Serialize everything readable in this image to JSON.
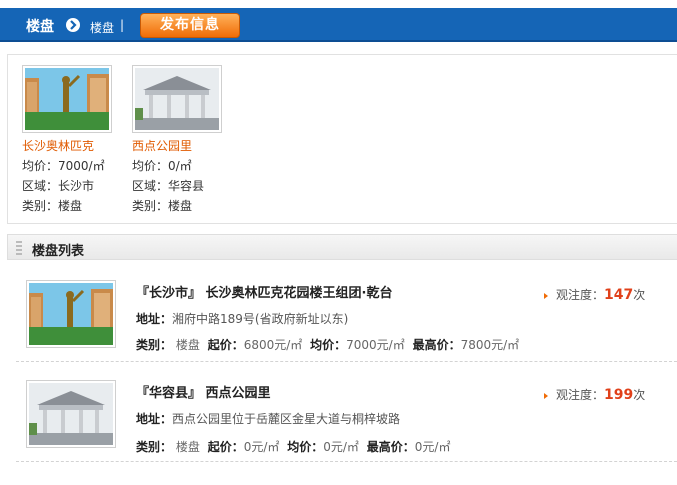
{
  "header": {
    "title": "楼盘",
    "crumb": "楼盘",
    "separator": "|",
    "publish_label": "发布信息"
  },
  "featured": [
    {
      "name": "长沙奥林匹克",
      "price": "均价：7000/㎡",
      "region": "区域：长沙市",
      "category": "类别：楼盘"
    },
    {
      "name": "西点公园里",
      "price": "均价：0/㎡",
      "region": "区域：华容县",
      "category": "类别：楼盘"
    }
  ],
  "list_section": {
    "title": "楼盘列表"
  },
  "list": [
    {
      "title": "『长沙市』 长沙奥林匹克花园楼王组团·乾台",
      "addr_label": "地址：",
      "addr": "湘府中路189号(省政府新址以东)",
      "type_label": "类别：",
      "type": "楼盘",
      "start_label": "起价：",
      "start": "6800元/㎡",
      "avg_label": "均价：",
      "avg": "7000元/㎡",
      "max_label": "最高价：",
      "max": "7800元/㎡",
      "views_label": "观注度：",
      "views": "147",
      "views_unit": "次"
    },
    {
      "title": "『华容县』 西点公园里",
      "addr_label": "地址：",
      "addr": "西点公园里位于岳麓区金星大道与桐梓坡路",
      "type_label": "类别：",
      "type": "楼盘",
      "start_label": "起价：",
      "start": "0元/㎡",
      "avg_label": "均价：",
      "avg": "0元/㎡",
      "max_label": "最高价：",
      "max": "0元/㎡",
      "views_label": "观注度：",
      "views": "199",
      "views_unit": "次"
    }
  ]
}
